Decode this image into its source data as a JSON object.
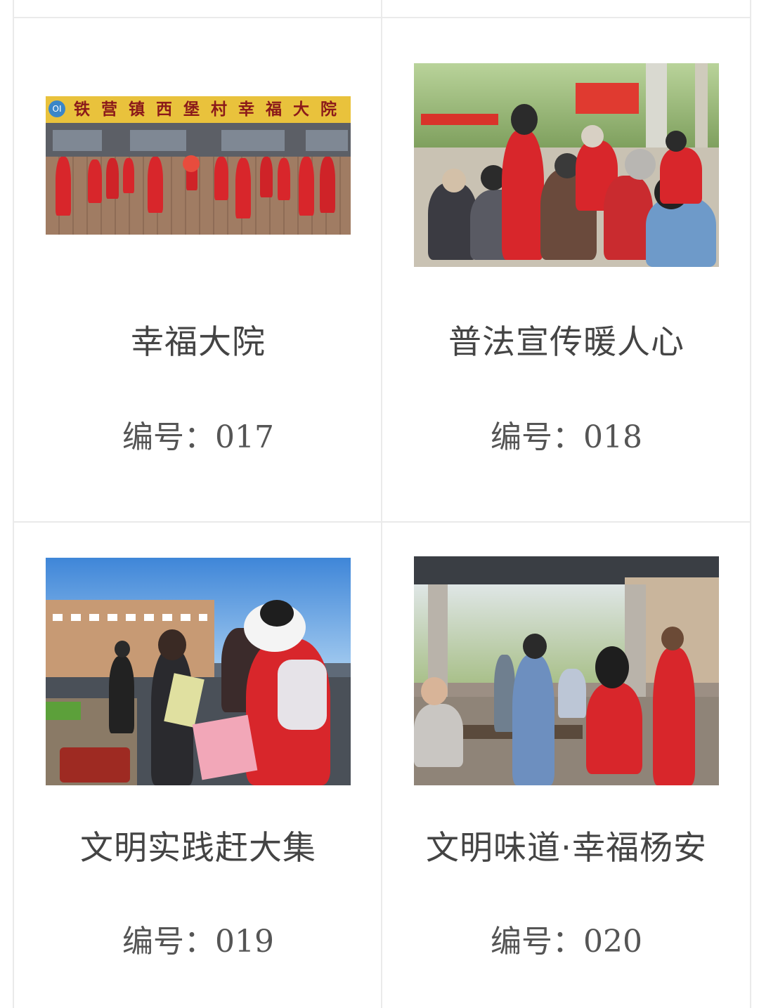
{
  "cards": [
    {
      "title": "幸福大院",
      "code_label": "编号：",
      "code_value": "017",
      "photo": {
        "sign_text": "铁营镇西堡村幸福大院",
        "logo_text": "OI",
        "icon": "dance-photo-icon"
      }
    },
    {
      "title": "普法宣传暖人心",
      "code_label": "编号：",
      "code_value": "018",
      "photo": {
        "icon": "legal-outreach-photo-icon"
      }
    },
    {
      "title": "文明实践赶大集",
      "code_label": "编号：",
      "code_value": "019",
      "photo": {
        "icon": "market-volunteer-photo-icon"
      }
    },
    {
      "title": "文明味道·幸福杨安",
      "code_label": "编号：",
      "code_value": "020",
      "photo": {
        "icon": "pavilion-volunteer-photo-icon"
      }
    }
  ],
  "colors": {
    "border": "#eaeaea",
    "title_text": "#444444",
    "code_text": "#555555",
    "volunteer_red": "#d8262b"
  }
}
